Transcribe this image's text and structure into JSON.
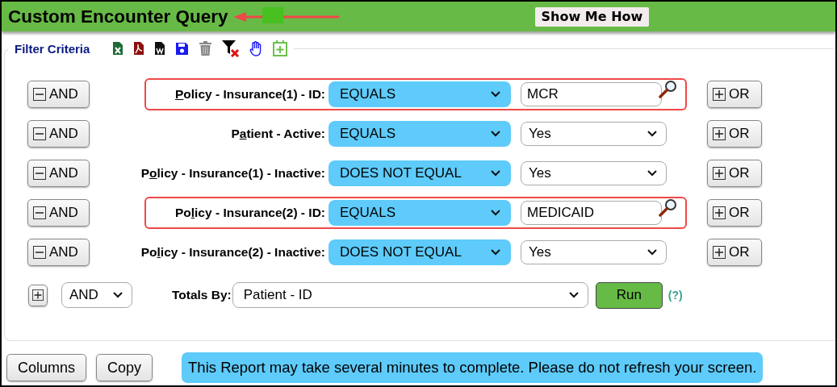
{
  "header": {
    "title": "Custom Encounter Query",
    "help_button": "Show Me How"
  },
  "filter": {
    "legend": "Filter Criteria",
    "criteria": [
      {
        "remove_button": "AND",
        "access_key": "P",
        "label_after": "olicy - Insurance(1) - ID:",
        "operator": "EQUALS",
        "kind": "text",
        "value": "MCR",
        "highlighted": true,
        "add_button": "OR"
      },
      {
        "remove_button": "AND",
        "label_before": "P",
        "access_key": "a",
        "label_after": "tient - Active:",
        "operator": "EQUALS",
        "kind": "select",
        "value": "Yes",
        "highlighted": false,
        "add_button": "OR"
      },
      {
        "remove_button": "AND",
        "label_before": "P",
        "access_key": "o",
        "label_after": "licy - Insurance(1) - Inactive:",
        "operator": "DOES NOT EQUAL",
        "kind": "select",
        "value": "Yes",
        "highlighted": false,
        "add_button": "OR"
      },
      {
        "remove_button": "AND",
        "label_before": "Po",
        "access_key": "l",
        "label_after": "icy - Insurance(2) - ID:",
        "operator": "EQUALS",
        "kind": "text",
        "value": "MEDICAID",
        "highlighted": true,
        "add_button": "OR"
      },
      {
        "remove_button": "AND",
        "label_before": "Po",
        "access_key": "l",
        "label_after": "icy - Insurance(2) - Inactive:",
        "operator": "DOES NOT EQUAL",
        "kind": "select",
        "value": "Yes",
        "highlighted": false,
        "add_button": "OR"
      }
    ],
    "join": "AND",
    "totals_label": "Totals By:",
    "totals_value": "Patient - ID",
    "run_button": "Run",
    "help_link": "(?)"
  },
  "footer": {
    "buttons": [
      "Columns",
      "Copy"
    ],
    "notice": "This Report may take several minutes to complete. Please do not refresh your screen."
  }
}
